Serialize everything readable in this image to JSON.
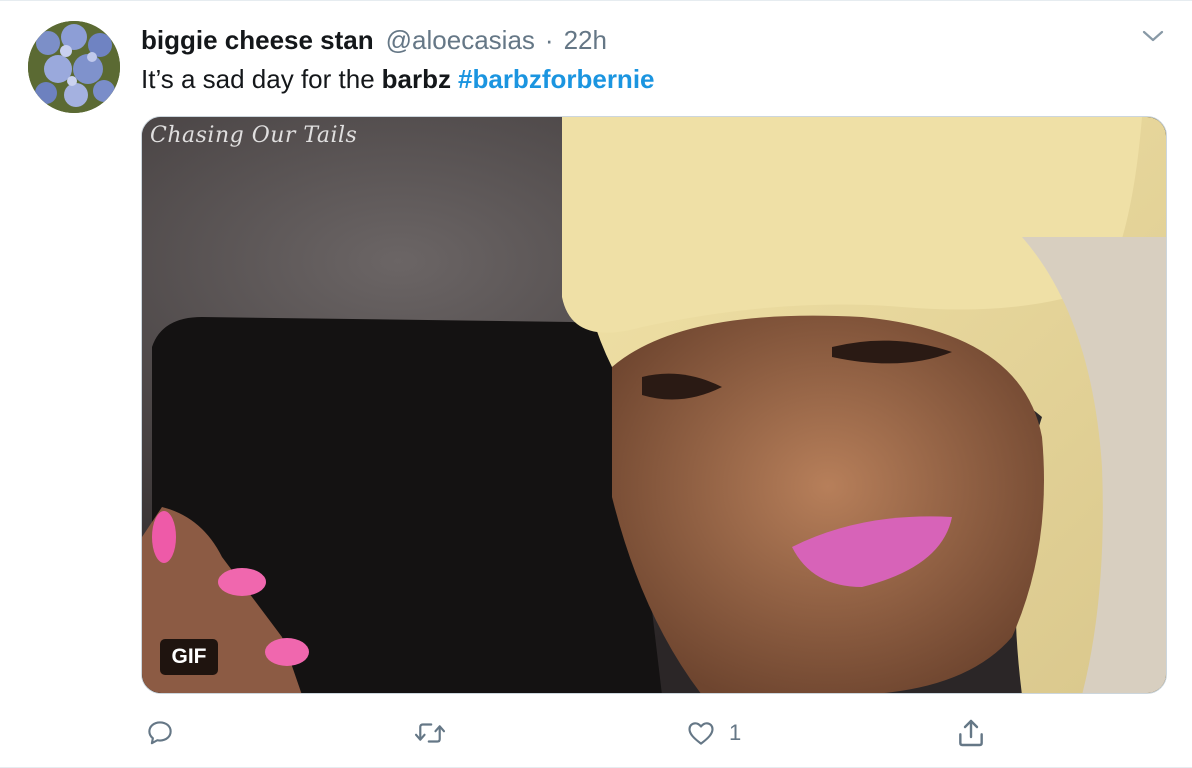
{
  "tweet": {
    "display_name": "biggie cheese stan",
    "handle": "@aloecasias",
    "separator": "·",
    "timestamp": "22h",
    "text_plain": "It’s a sad day for the",
    "text_bold": "barbz",
    "hashtag": "#barbzforbernie"
  },
  "media": {
    "watermark": "Chasing Our Tails",
    "badge": "GIF"
  },
  "actions": {
    "reply_count": "",
    "retweet_count": "",
    "like_count": "1",
    "share_count": ""
  },
  "icons": {
    "caret": "chevron-down-icon",
    "reply": "reply-icon",
    "retweet": "retweet-icon",
    "like": "heart-icon",
    "share": "share-icon"
  },
  "colors": {
    "text": "#14171a",
    "secondary": "#657786",
    "link": "#1b95e0",
    "border": "#e6ecf0"
  }
}
